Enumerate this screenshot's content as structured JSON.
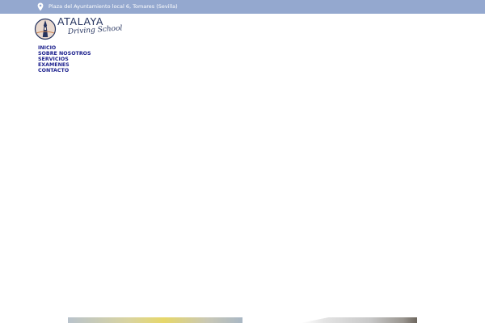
{
  "topbar": {
    "icon": "map-pin-icon",
    "address": "Plaza del Ayuntamiento local 6, Tomares (Sevilla)"
  },
  "logo": {
    "brand": "ATALAYA",
    "tagline": "Driving School"
  },
  "nav": {
    "items": [
      {
        "label": "INICIO"
      },
      {
        "label": "SOBRE NOSOTROS"
      },
      {
        "label": "SERVICIOS"
      },
      {
        "label": "EXAMENES"
      },
      {
        "label": "CONTACTO"
      }
    ]
  },
  "colors": {
    "topbar_bg": "#94a8cf",
    "nav_text": "#1a1e8c",
    "brand_text": "#26345f"
  }
}
